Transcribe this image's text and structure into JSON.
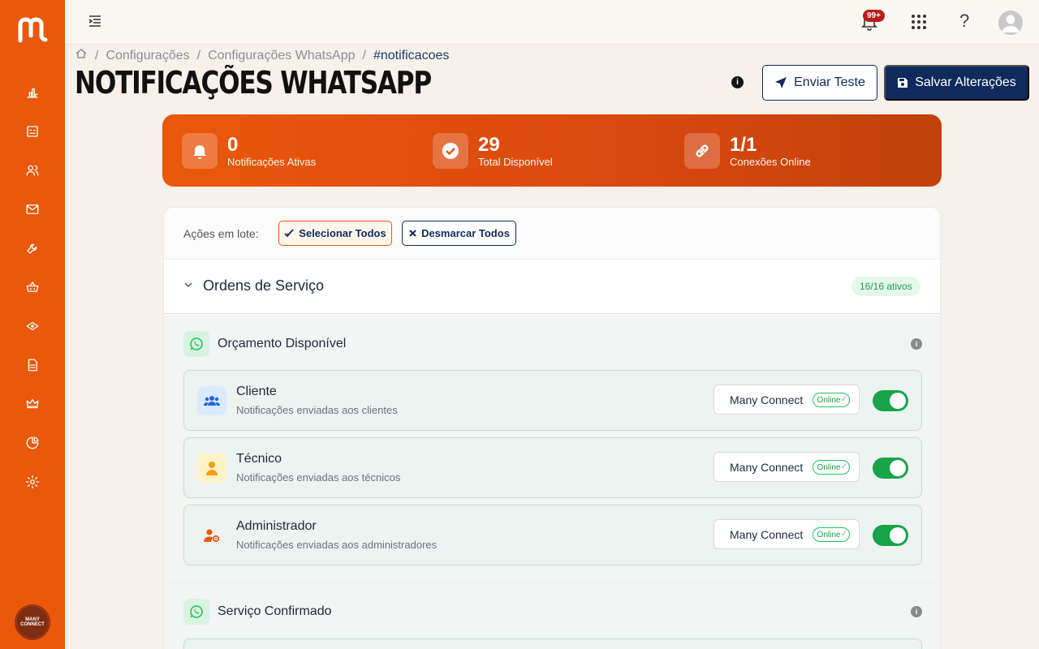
{
  "sidebar": {
    "logo": "m",
    "items": [
      {
        "icon": "bar-chart-icon"
      },
      {
        "icon": "dashboard-screen-icon"
      },
      {
        "icon": "users-icon"
      },
      {
        "icon": "mail-icon"
      },
      {
        "icon": "wrench-icon"
      },
      {
        "icon": "basket-icon"
      },
      {
        "icon": "money-icon"
      },
      {
        "icon": "document-icon"
      },
      {
        "icon": "crown-icon"
      },
      {
        "icon": "pie-chart-icon"
      },
      {
        "icon": "gear-icon"
      }
    ],
    "avatar_text": "MANY CONNECT"
  },
  "topbar": {
    "notifications_badge": "99+",
    "help": "?"
  },
  "breadcrumb": {
    "items": [
      "Configurações",
      "Configurações WhatsApp"
    ],
    "current": "#notificacoes"
  },
  "page": {
    "title": "NOTIFICAÇÕES WHATSAPP",
    "send_test_label": "Enviar Teste",
    "save_label": "Salvar Alterações"
  },
  "stats": [
    {
      "value": "0",
      "label": "Notificações Ativas",
      "icon": "bell-icon"
    },
    {
      "value": "29",
      "label": "Total Disponível",
      "icon": "check-circle-icon"
    },
    {
      "value": "1/1",
      "label": "Conexões Online",
      "icon": "link-icon"
    }
  ],
  "batch": {
    "label": "Ações em lote:",
    "select_all": "Selecionar Todos",
    "deselect_all": "Desmarcar Todos"
  },
  "section": {
    "title": "Ordens de Serviço",
    "active_count": "16/16 ativos"
  },
  "groups": [
    {
      "title": "Orçamento Disponível",
      "rows": [
        {
          "title": "Cliente",
          "subtitle": "Notificações enviadas aos clientes",
          "connection": "Many Connect",
          "status": "Online",
          "enabled": true
        },
        {
          "title": "Técnico",
          "subtitle": "Notificações enviadas aos técnicos",
          "connection": "Many Connect",
          "status": "Online",
          "enabled": true
        },
        {
          "title": "Administrador",
          "subtitle": "Notificações enviadas aos administradores",
          "connection": "Many Connect",
          "status": "Online",
          "enabled": true
        }
      ]
    },
    {
      "title": "Serviço Confirmado",
      "rows": []
    }
  ],
  "colors": {
    "brand_orange": "#ea580c",
    "navy": "#0f2a5c",
    "success_green": "#16a34a"
  }
}
